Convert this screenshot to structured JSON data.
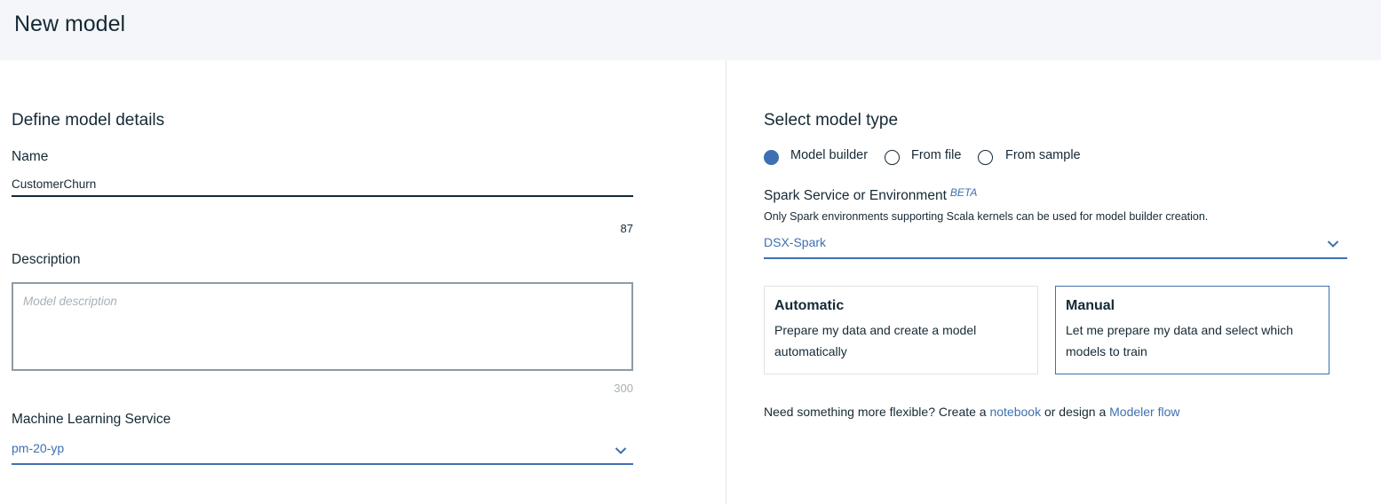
{
  "header": {
    "title": "New model"
  },
  "details": {
    "title": "Define model details",
    "name_label": "Name",
    "name_value": "CustomerChurn",
    "name_counter": "87",
    "description_label": "Description",
    "description_placeholder": "Model description",
    "description_counter": "300",
    "ml_service_label": "Machine Learning Service",
    "ml_service_value": "pm-20-yp"
  },
  "model_type": {
    "title": "Select model type",
    "options": [
      {
        "label": "Model builder",
        "checked": true
      },
      {
        "label": "From file",
        "checked": false
      },
      {
        "label": "From sample",
        "checked": false
      }
    ],
    "spark_label": "Spark Service or Environment",
    "spark_badge": "BETA",
    "spark_helper": "Only Spark environments supporting Scala kernels can be used for model builder creation.",
    "spark_value": "DSX-Spark",
    "tiles": [
      {
        "title": "Automatic",
        "desc_line1": "Prepare my data and create a model",
        "desc_line2": "automatically"
      },
      {
        "title": "Manual",
        "desc_line1": "Let me prepare my data and select which",
        "desc_line2": "models to train"
      }
    ],
    "footer": {
      "prefix": "Need something more flexible? Create a ",
      "notebook_link": "notebook",
      "middle": " or design a ",
      "modeler_link": "Modeler flow"
    }
  },
  "colors": {
    "accent": "#3d70b2",
    "text": "#152935",
    "header_bg": "#f4f6f9"
  }
}
